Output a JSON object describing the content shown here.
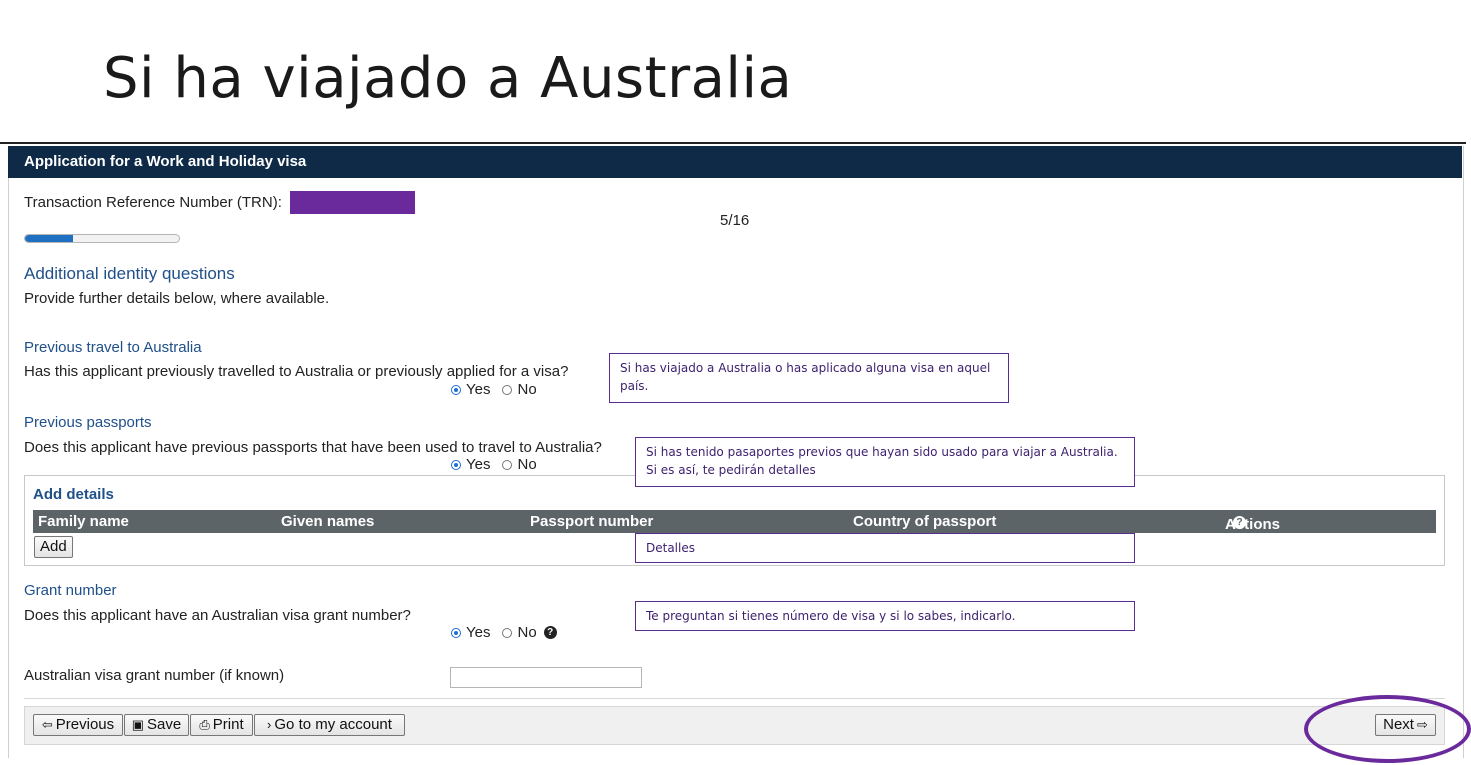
{
  "slide_title": "Si ha viajado a Australia",
  "app": {
    "header_title": "Application for a Work and Holiday visa",
    "trn_label": "Transaction Reference Number (TRN):",
    "step_counter": "5/16",
    "progress_fraction": 0.3125
  },
  "section": {
    "title": "Additional identity questions",
    "intro": "Provide further details below, where available."
  },
  "previous_travel": {
    "title": "Previous travel to Australia",
    "question": "Has this applicant previously travelled to Australia or previously applied for a visa?",
    "yes_label": "Yes",
    "no_label": "No",
    "selected": "Yes"
  },
  "previous_passports": {
    "title": "Previous passports",
    "question": "Does this applicant have previous passports that have been used to travel to Australia?",
    "yes_label": "Yes",
    "no_label": "No",
    "selected": "Yes"
  },
  "details_table": {
    "title": "Add details",
    "columns": [
      "Family name",
      "Given names",
      "Passport number",
      "Country of passport",
      "Actions"
    ],
    "add_label": "Add"
  },
  "grant_number": {
    "title": "Grant number",
    "question": "Does this applicant have an Australian visa grant number?",
    "yes_label": "Yes",
    "no_label": "No",
    "selected": "Yes",
    "field_label": "Australian visa grant number (if known)",
    "field_value": ""
  },
  "footer": {
    "previous_label": "Previous",
    "save_label": "Save",
    "print_label": "Print",
    "account_label": "Go to my account",
    "next_label": "Next"
  },
  "annotations": {
    "travel_note": "Si has viajado a Australia o has aplicado alguna visa en aquel país.",
    "passports_note": "Si has tenido pasaportes previos que hayan sido usado para viajar a Australia. Si es así, te pedirán detalles",
    "details_note": "Detalles",
    "grant_note": "Te preguntan si tienes número de visa y si lo sabes, indicarlo."
  },
  "colors": {
    "header_bg": "#0e2a47",
    "accent_blue": "#20508a",
    "annotation_purple": "#6a2a9c",
    "table_head_bg": "#5d6468"
  }
}
